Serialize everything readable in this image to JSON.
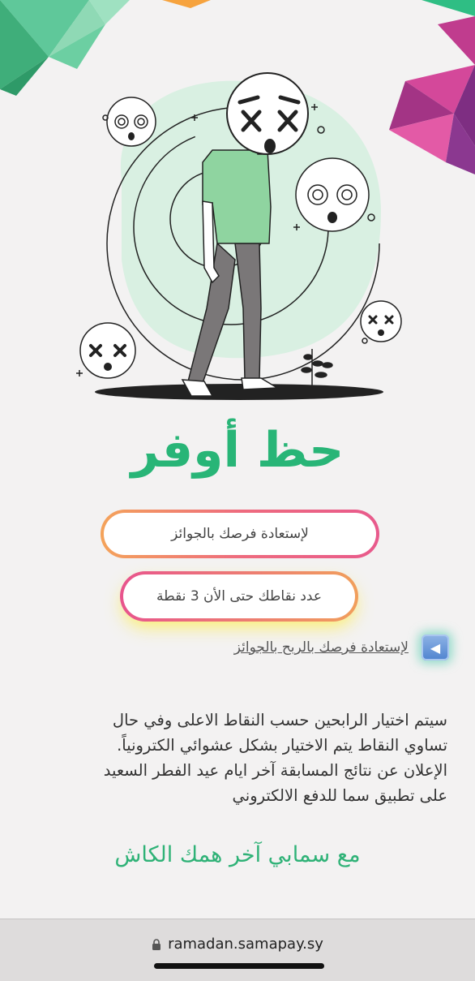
{
  "title": "حظ أوفر",
  "buttons": {
    "restore_chances": "لإستعادة فرصك بالجوائز",
    "points_status": "عدد نقاطك حتى الأن 3 نقطة"
  },
  "link": {
    "text": "لإستعادة فرصك بالربح بالجوائز",
    "icon": "play-left-icon"
  },
  "paragraph": [
    "سيتم اختيار الرابحين حسب النقاط الاعلى وفي حال",
    "تساوي النقاط يتم الاختيار بشكل عشوائي الكترونياً.",
    "الإعلان عن نتائج المسابقة آخر ايام عيد الفطر السعيد",
    "على تطبيق سما للدفع الالكتروني"
  ],
  "slogan": "مع سمابي آخر همك الكاش",
  "browser": {
    "url": "ramadan.samapay.sy",
    "lock_icon": "lock-icon"
  },
  "colors": {
    "accent_green": "#28b577",
    "background": "#f3f2f2",
    "gradient_orange": "#f4a35a",
    "gradient_pink": "#e85a8c"
  }
}
